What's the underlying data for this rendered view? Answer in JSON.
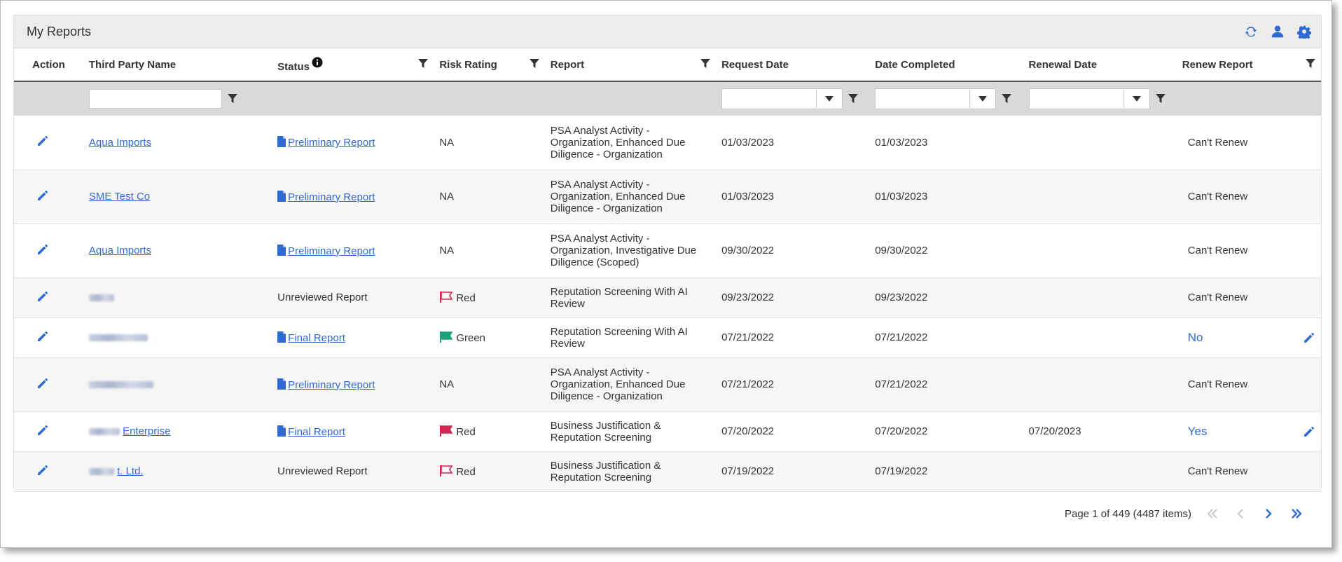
{
  "panel": {
    "title": "My Reports"
  },
  "colors": {
    "accent": "#2f6ad3",
    "red_flag": "#d1264f",
    "green_flag": "#1aa37a"
  },
  "columns": {
    "action": "Action",
    "third_party": "Third Party Name",
    "status": "Status",
    "risk": "Risk Rating",
    "report": "Report",
    "request_date": "Request Date",
    "date_completed": "Date Completed",
    "renewal_date": "Renewal Date",
    "renew_report": "Renew Report"
  },
  "filters": {
    "third_party": "",
    "request_date": "",
    "date_completed": "",
    "renewal_date": ""
  },
  "rows": [
    {
      "party": "Aqua Imports",
      "status": "Preliminary Report",
      "risk": "NA",
      "report": "PSA Analyst Activity - Organization, Enhanced Due Diligence - Organization",
      "request": "01/03/2023",
      "completed": "01/03/2023",
      "renewal": "",
      "renew": "Can't Renew"
    },
    {
      "party": "SME Test Co",
      "status": "Preliminary Report",
      "risk": "NA",
      "report": "PSA Analyst Activity - Organization, Enhanced Due Diligence - Organization",
      "request": "01/03/2023",
      "completed": "01/03/2023",
      "renewal": "",
      "renew": "Can't Renew"
    },
    {
      "party": "Aqua Imports",
      "status": "Preliminary Report",
      "risk": "NA",
      "report": "PSA Analyst Activity - Organization, Investigative Due Diligence (Scoped)",
      "request": "09/30/2022",
      "completed": "09/30/2022",
      "renewal": "",
      "renew": "Can't Renew"
    },
    {
      "party": "",
      "status": "Unreviewed Report",
      "risk": "Red",
      "report": "Reputation Screening With AI Review",
      "request": "09/23/2022",
      "completed": "09/23/2022",
      "renewal": "",
      "renew": "Can't Renew"
    },
    {
      "party": "",
      "status": "Final Report",
      "risk": "Green",
      "report": "Reputation Screening With AI Review",
      "request": "07/21/2022",
      "completed": "07/21/2022",
      "renewal": "",
      "renew": "No"
    },
    {
      "party": "",
      "status": "Preliminary Report",
      "risk": "NA",
      "report": "PSA Analyst Activity - Organization, Enhanced Due Diligence - Organization",
      "request": "07/21/2022",
      "completed": "07/21/2022",
      "renewal": "",
      "renew": "Can't Renew"
    },
    {
      "party": "Enterprise",
      "status": "Final Report",
      "risk": "Red",
      "report": "Business Justification & Reputation Screening",
      "request": "07/20/2022",
      "completed": "07/20/2022",
      "renewal": "07/20/2023",
      "renew": "Yes"
    },
    {
      "party": "t. Ltd.",
      "status": "Unreviewed Report",
      "risk": "Red",
      "report": "Business Justification & Reputation Screening",
      "request": "07/19/2022",
      "completed": "07/19/2022",
      "renewal": "",
      "renew": "Can't Renew"
    }
  ],
  "pager": {
    "summary": "Page 1 of 449 (4487 items)"
  }
}
